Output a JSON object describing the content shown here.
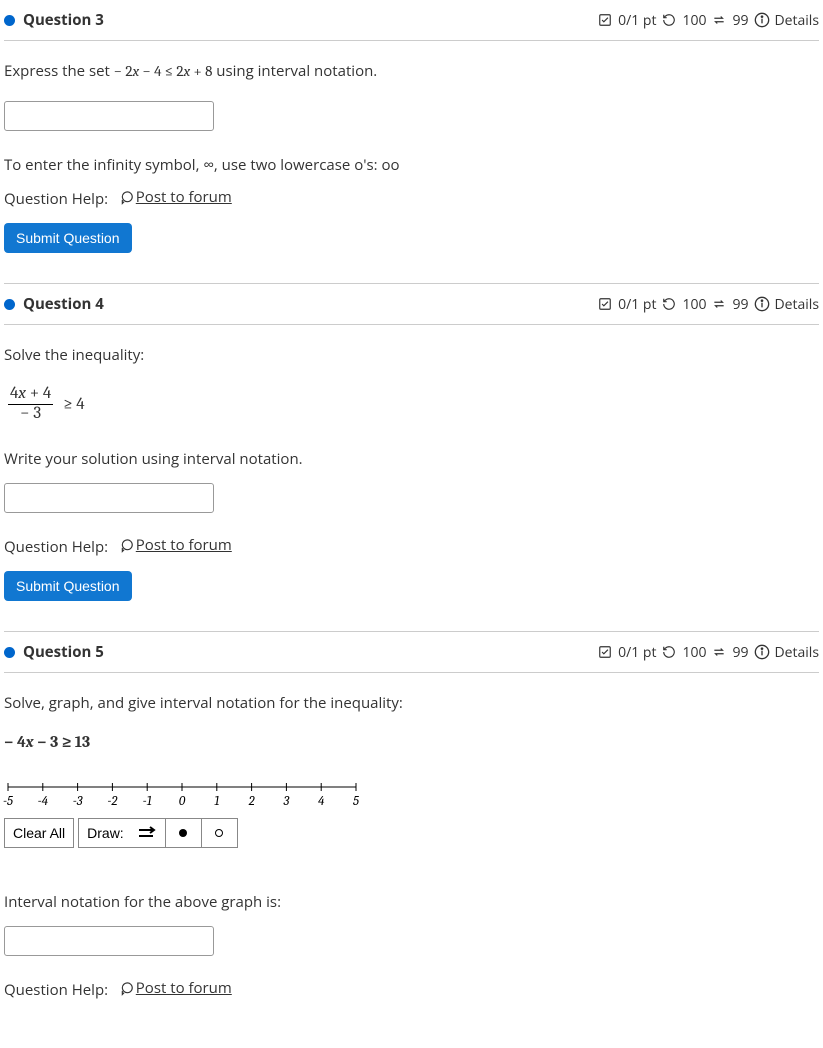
{
  "questions": [
    {
      "title": "Question 3",
      "score": "0/1 pt",
      "retry": "100",
      "attempts": "99",
      "details": "Details",
      "prompt_pre": "Express the set ",
      "prompt_math": "− 2x − 4 ≤ 2x + 8",
      "prompt_post": " using interval notation.",
      "hint": "To enter the infinity symbol, ∞, use two lowercase o's: oo",
      "help_label": "Question Help:",
      "help_link": " Post to forum",
      "submit": "Submit Question"
    },
    {
      "title": "Question 4",
      "score": "0/1 pt",
      "retry": "100",
      "attempts": "99",
      "details": "Details",
      "prompt": "Solve the inequality:",
      "frac_num": "4x + 4",
      "frac_den": "− 3",
      "rhs": "≥ 4",
      "sub_prompt": "Write your solution using interval notation.",
      "help_label": "Question Help:",
      "help_link": " Post to forum",
      "submit": "Submit Question"
    },
    {
      "title": "Question 5",
      "score": "0/1 pt",
      "retry": "100",
      "attempts": "99",
      "details": "Details",
      "prompt": "Solve, graph, and give interval notation for the inequality:",
      "math": "− 4x − 3 ≥ 13",
      "ticks": [
        "-5",
        "-4",
        "-3",
        "-2",
        "-1",
        "0",
        "1",
        "2",
        "3",
        "4",
        "5"
      ],
      "clear": "Clear All",
      "draw": "Draw:",
      "interval_label": "Interval notation for the above graph is:",
      "help_label": "Question Help:",
      "help_link": " Post to forum"
    }
  ]
}
